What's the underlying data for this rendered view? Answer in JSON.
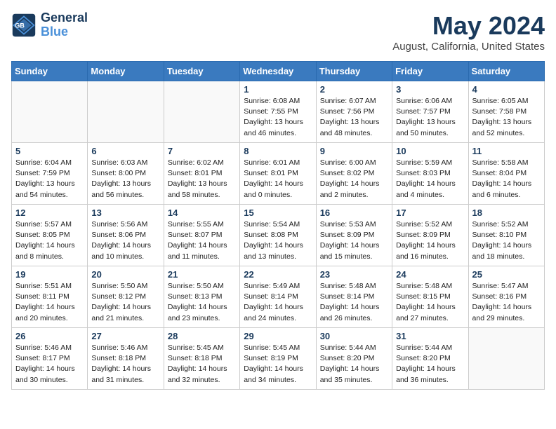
{
  "logo": {
    "line1": "General",
    "line2": "Blue"
  },
  "title": "May 2024",
  "subtitle": "August, California, United States",
  "days_header": [
    "Sunday",
    "Monday",
    "Tuesday",
    "Wednesday",
    "Thursday",
    "Friday",
    "Saturday"
  ],
  "weeks": [
    [
      {
        "day": "",
        "info": ""
      },
      {
        "day": "",
        "info": ""
      },
      {
        "day": "",
        "info": ""
      },
      {
        "day": "1",
        "info": "Sunrise: 6:08 AM\nSunset: 7:55 PM\nDaylight: 13 hours\nand 46 minutes."
      },
      {
        "day": "2",
        "info": "Sunrise: 6:07 AM\nSunset: 7:56 PM\nDaylight: 13 hours\nand 48 minutes."
      },
      {
        "day": "3",
        "info": "Sunrise: 6:06 AM\nSunset: 7:57 PM\nDaylight: 13 hours\nand 50 minutes."
      },
      {
        "day": "4",
        "info": "Sunrise: 6:05 AM\nSunset: 7:58 PM\nDaylight: 13 hours\nand 52 minutes."
      }
    ],
    [
      {
        "day": "5",
        "info": "Sunrise: 6:04 AM\nSunset: 7:59 PM\nDaylight: 13 hours\nand 54 minutes."
      },
      {
        "day": "6",
        "info": "Sunrise: 6:03 AM\nSunset: 8:00 PM\nDaylight: 13 hours\nand 56 minutes."
      },
      {
        "day": "7",
        "info": "Sunrise: 6:02 AM\nSunset: 8:01 PM\nDaylight: 13 hours\nand 58 minutes."
      },
      {
        "day": "8",
        "info": "Sunrise: 6:01 AM\nSunset: 8:01 PM\nDaylight: 14 hours\nand 0 minutes."
      },
      {
        "day": "9",
        "info": "Sunrise: 6:00 AM\nSunset: 8:02 PM\nDaylight: 14 hours\nand 2 minutes."
      },
      {
        "day": "10",
        "info": "Sunrise: 5:59 AM\nSunset: 8:03 PM\nDaylight: 14 hours\nand 4 minutes."
      },
      {
        "day": "11",
        "info": "Sunrise: 5:58 AM\nSunset: 8:04 PM\nDaylight: 14 hours\nand 6 minutes."
      }
    ],
    [
      {
        "day": "12",
        "info": "Sunrise: 5:57 AM\nSunset: 8:05 PM\nDaylight: 14 hours\nand 8 minutes."
      },
      {
        "day": "13",
        "info": "Sunrise: 5:56 AM\nSunset: 8:06 PM\nDaylight: 14 hours\nand 10 minutes."
      },
      {
        "day": "14",
        "info": "Sunrise: 5:55 AM\nSunset: 8:07 PM\nDaylight: 14 hours\nand 11 minutes."
      },
      {
        "day": "15",
        "info": "Sunrise: 5:54 AM\nSunset: 8:08 PM\nDaylight: 14 hours\nand 13 minutes."
      },
      {
        "day": "16",
        "info": "Sunrise: 5:53 AM\nSunset: 8:09 PM\nDaylight: 14 hours\nand 15 minutes."
      },
      {
        "day": "17",
        "info": "Sunrise: 5:52 AM\nSunset: 8:09 PM\nDaylight: 14 hours\nand 16 minutes."
      },
      {
        "day": "18",
        "info": "Sunrise: 5:52 AM\nSunset: 8:10 PM\nDaylight: 14 hours\nand 18 minutes."
      }
    ],
    [
      {
        "day": "19",
        "info": "Sunrise: 5:51 AM\nSunset: 8:11 PM\nDaylight: 14 hours\nand 20 minutes."
      },
      {
        "day": "20",
        "info": "Sunrise: 5:50 AM\nSunset: 8:12 PM\nDaylight: 14 hours\nand 21 minutes."
      },
      {
        "day": "21",
        "info": "Sunrise: 5:50 AM\nSunset: 8:13 PM\nDaylight: 14 hours\nand 23 minutes."
      },
      {
        "day": "22",
        "info": "Sunrise: 5:49 AM\nSunset: 8:14 PM\nDaylight: 14 hours\nand 24 minutes."
      },
      {
        "day": "23",
        "info": "Sunrise: 5:48 AM\nSunset: 8:14 PM\nDaylight: 14 hours\nand 26 minutes."
      },
      {
        "day": "24",
        "info": "Sunrise: 5:48 AM\nSunset: 8:15 PM\nDaylight: 14 hours\nand 27 minutes."
      },
      {
        "day": "25",
        "info": "Sunrise: 5:47 AM\nSunset: 8:16 PM\nDaylight: 14 hours\nand 29 minutes."
      }
    ],
    [
      {
        "day": "26",
        "info": "Sunrise: 5:46 AM\nSunset: 8:17 PM\nDaylight: 14 hours\nand 30 minutes."
      },
      {
        "day": "27",
        "info": "Sunrise: 5:46 AM\nSunset: 8:18 PM\nDaylight: 14 hours\nand 31 minutes."
      },
      {
        "day": "28",
        "info": "Sunrise: 5:45 AM\nSunset: 8:18 PM\nDaylight: 14 hours\nand 32 minutes."
      },
      {
        "day": "29",
        "info": "Sunrise: 5:45 AM\nSunset: 8:19 PM\nDaylight: 14 hours\nand 34 minutes."
      },
      {
        "day": "30",
        "info": "Sunrise: 5:44 AM\nSunset: 8:20 PM\nDaylight: 14 hours\nand 35 minutes."
      },
      {
        "day": "31",
        "info": "Sunrise: 5:44 AM\nSunset: 8:20 PM\nDaylight: 14 hours\nand 36 minutes."
      },
      {
        "day": "",
        "info": ""
      }
    ]
  ]
}
